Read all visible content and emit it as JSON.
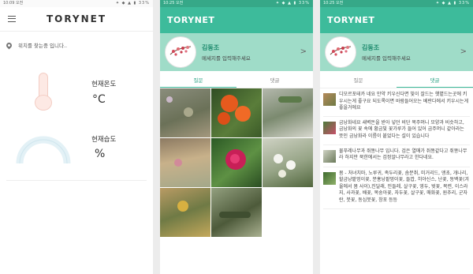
{
  "screen1": {
    "status_time": "10:09 오전",
    "status_icons": "✦ ◆ ▲ ▮ 33%",
    "logo": "TORYNET",
    "location_text": "위치를 찾는중 입니다..",
    "temp_label": "현재온도",
    "temp_unit": "°C",
    "humidity_label": "현재습도",
    "humidity_unit": "%"
  },
  "screen2": {
    "status_time": "10:25 오전",
    "status_icons": "✦ ◆ ▲ ▮ 33%",
    "app_title": "TORYNET",
    "profile_name": "김동조",
    "profile_message": "메세지를 입력해주세요",
    "tabs": [
      "질문",
      "댓글"
    ],
    "active_tab": "질문"
  },
  "screen3": {
    "status_time": "10:25 오전",
    "status_icons": "✦ ◆ ▲ ▮ 33%",
    "app_title": "TORYNET",
    "profile_name": "김동조",
    "profile_message": "메세지를 입력해주세요",
    "tabs": [
      "질문",
      "댓글"
    ],
    "active_tab": "댓글",
    "comments": [
      "디모르포테카 네요 만약 키우신다면 빛이 잘드는 햇볕드는곳에 키우시는게 좋구요 되도록이면 바람들어오는 베란다에서 키우시는게 좋을거에요",
      "금낭화네요 새벽돈을 받아 넣던 비단 복주머니 모양과 비슷하고, 금낭화의 꽃 속에 황금빛 꽃가루가 들어 있어 금주머니 같아라는 뜻인 금낭화라 이름이 붙었다는 설이 있습니다",
      "물푸레나무과 쥐똥나무 입니다. 검은 열매가 쥐똥같다고 쥐똥나무라 하지만 북한에서는 검정알나무라고 한다네요.",
      "봄 - 처녀치마, 노루귀, 족두리꽃, 솜분취, 미거리드, 앵초, 개나리, 할금낭팥멍이꽃, 분홍낭팥멍이꽃, 들깝, 히야신스, 난꽃, 동백꽃(겨울에서 봄 사이),진달래, 민들레, 살구꽃, 영두, 벚꽃, 목련, 이스라지, 사과꽃, 배꽃, 복숭아꽃, 자두꽃, 살구꽃, 매화꽃, 원추리, 군자란, 붓꽃, 동심붓꽃, 창포 등등"
    ]
  }
}
